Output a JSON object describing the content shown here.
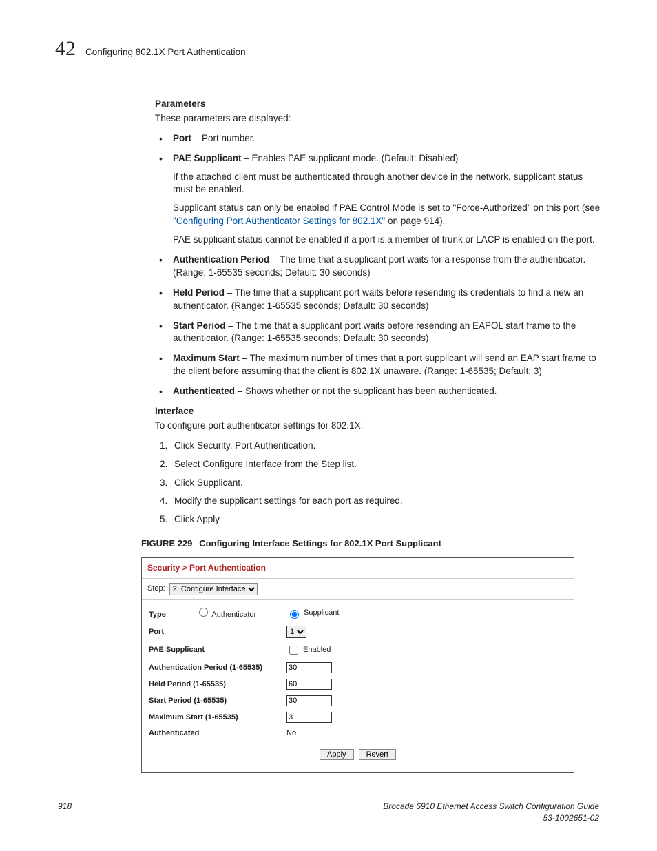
{
  "header": {
    "chapter_number": "42",
    "chapter_title": "Configuring 802.1X Port Authentication"
  },
  "section_parameters": {
    "heading": "Parameters",
    "intro": "These parameters are displayed:"
  },
  "bullets": {
    "port": {
      "term": "Port",
      "desc": " – Port number."
    },
    "pae": {
      "term": "PAE Supplicant",
      "desc": " – Enables PAE supplicant mode. (Default: Disabled)",
      "sub1": "If the attached client must be authenticated through another device in the network, supplicant status must be enabled.",
      "sub2_a": "Supplicant status can only be enabled if PAE Control Mode is set to \"Force-Authorized\" on this port (see ",
      "sub2_link": "\"Configuring Port Authenticator Settings for 802.1X\"",
      "sub2_b": " on page 914).",
      "sub3": "PAE supplicant status cannot be enabled if a port is a member of trunk or LACP is enabled on the port."
    },
    "authp": {
      "term": "Authentication Period",
      "desc": " – The time that a supplicant port waits for a response from the authenticator. (Range: 1-65535 seconds; Default: 30 seconds)"
    },
    "heldp": {
      "term": "Held Period",
      "desc": " – The time that a supplicant port waits before resending its credentials to find a new an authenticator. (Range: 1-65535 seconds; Default: 30 seconds)"
    },
    "startp": {
      "term": "Start Period",
      "desc": " – The time that a supplicant port waits before resending an EAPOL start frame to the authenticator. (Range: 1-65535 seconds; Default: 30 seconds)"
    },
    "maxs": {
      "term": "Maximum Start",
      "desc": " – The maximum number of times that a port supplicant will send an EAP start frame to the client before assuming that the client is 802.1X unaware. (Range: 1-65535; Default: 3)"
    },
    "auth": {
      "term": "Authenticated",
      "desc": " – Shows whether or not the supplicant has been authenticated."
    }
  },
  "section_interface": {
    "heading": "Interface",
    "intro": "To configure port authenticator settings for 802.1X:",
    "steps": [
      "Click Security, Port Authentication.",
      "Select Configure Interface from the Step list.",
      "Click Supplicant.",
      "Modify the supplicant settings for each port as required.",
      "Click Apply"
    ]
  },
  "figure": {
    "label": "FIGURE 229",
    "caption": "Configuring Interface Settings for 802.1X Port Supplicant"
  },
  "panel": {
    "breadcrumb": "Security > Port Authentication",
    "step_label": "Step:",
    "step_value": "2. Configure Interface",
    "rows": {
      "type_label": "Type",
      "type_authenticator": "Authenticator",
      "type_supplicant": "Supplicant",
      "port_label": "Port",
      "port_value": "1",
      "pae_label": "PAE Supplicant",
      "pae_enabled": "Enabled",
      "authp_label": "Authentication Period (1-65535)",
      "authp_value": "30",
      "heldp_label": "Held Period (1-65535)",
      "heldp_value": "60",
      "startp_label": "Start Period (1-65535)",
      "startp_value": "30",
      "maxs_label": "Maximum Start (1-65535)",
      "maxs_value": "3",
      "auth_label": "Authenticated",
      "auth_value": "No"
    },
    "apply": "Apply",
    "revert": "Revert"
  },
  "footer": {
    "page": "918",
    "doc_title": "Brocade 6910 Ethernet Access Switch Configuration Guide",
    "doc_num": "53-1002651-02"
  }
}
